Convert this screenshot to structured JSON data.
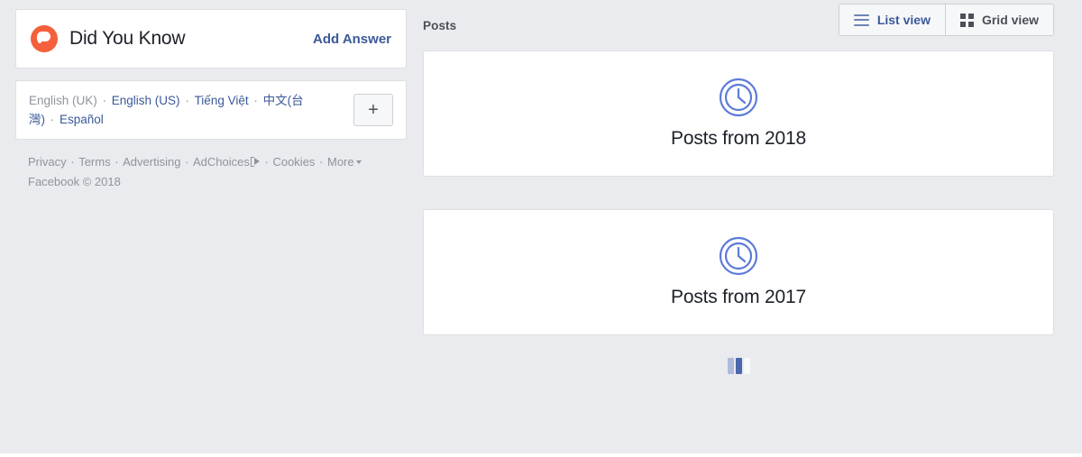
{
  "colors": {
    "page_background": "#e9ebee",
    "card_background": "#ffffff",
    "link_blue": "#3b5998",
    "muted_gray": "#90949c",
    "text_dark": "#1d2129",
    "logo_orange": "#f4603b",
    "icon_blue": "#5c7bd9"
  },
  "sidebar": {
    "did_you_know": {
      "logo_icon": "speech-bubble-icon",
      "title": "Did You Know",
      "action_label": "Add Answer"
    },
    "languages": {
      "items": [
        {
          "label": "English (UK)",
          "current": true
        },
        {
          "label": "English (US)",
          "current": false
        },
        {
          "label": "Tiếng Việt",
          "current": false
        },
        {
          "label": "中文(台灣)",
          "current": false
        },
        {
          "label": "Español",
          "current": false
        }
      ],
      "separator": "·",
      "add_button_label": "+",
      "add_button_icon": "plus-icon"
    },
    "footer": {
      "links": [
        "Privacy",
        "Terms",
        "Advertising",
        "AdChoices",
        "Cookies",
        "More"
      ],
      "adchoices_icon": "adchoices-triangle-icon",
      "more_caret_icon": "caret-down-icon",
      "separator": "·",
      "copyright": "Facebook © 2018"
    }
  },
  "main": {
    "header": {
      "title": "Posts",
      "view_toggle": {
        "list_view": {
          "label": "List view",
          "icon": "list-lines-icon",
          "active": true
        },
        "grid_view": {
          "label": "Grid view",
          "icon": "grid-squares-icon",
          "active": false
        }
      }
    },
    "post_cards": [
      {
        "icon": "clock-icon",
        "label": "Posts from 2018"
      },
      {
        "icon": "clock-icon",
        "label": "Posts from 2017"
      }
    ],
    "loader": {
      "icon": "loading-bars-icon",
      "bars": 3
    }
  }
}
